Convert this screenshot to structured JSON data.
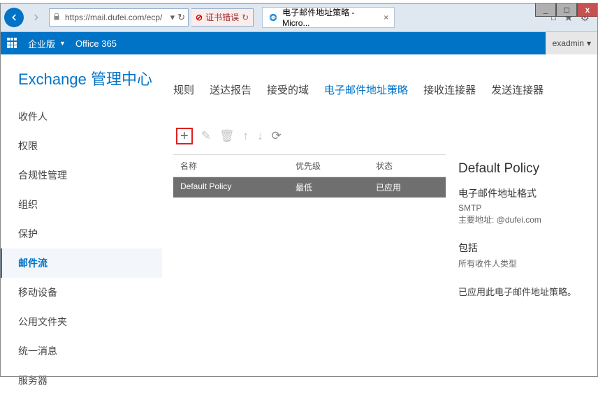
{
  "window": {
    "url": "https://mail.dufei.com/ecp/",
    "cert_error": "证书错误",
    "tab_title": "电子邮件地址策略 - Micro...",
    "min": "_",
    "max": "□",
    "close": "x"
  },
  "o365": {
    "edition": "企业版",
    "product": "Office 365",
    "user": "exadmin",
    "user_arrow": "▾"
  },
  "page_title": "Exchange 管理中心",
  "sidebar": {
    "items": [
      "收件人",
      "权限",
      "合规性管理",
      "组织",
      "保护",
      "邮件流",
      "移动设备",
      "公用文件夹",
      "统一消息",
      "服务器"
    ],
    "active_index": 5
  },
  "tabs": {
    "items": [
      "规则",
      "送达报告",
      "接受的域",
      "电子邮件地址策略",
      "接收连接器",
      "发送连接器"
    ],
    "active_index": 3
  },
  "toolbar_icons": {
    "add": "+",
    "edit": "✎",
    "delete": "🗑",
    "up": "↑",
    "down": "↓",
    "refresh": "⟳"
  },
  "table": {
    "headers": {
      "name": "名称",
      "priority": "优先级",
      "status": "状态"
    },
    "row": {
      "name": "Default Policy",
      "priority": "最低",
      "status": "已应用"
    }
  },
  "detail": {
    "title": "Default Policy",
    "fmt_h": "电子邮件地址格式",
    "fmt_1": "SMTP",
    "fmt_2": "主要地址: @dufei.com",
    "inc_h": "包括",
    "inc_1": "所有收件人类型",
    "applied": "已应用此电子邮件地址策略。"
  },
  "ie_icons": {
    "home": "⌂",
    "star": "★",
    "gear": "⚙"
  }
}
